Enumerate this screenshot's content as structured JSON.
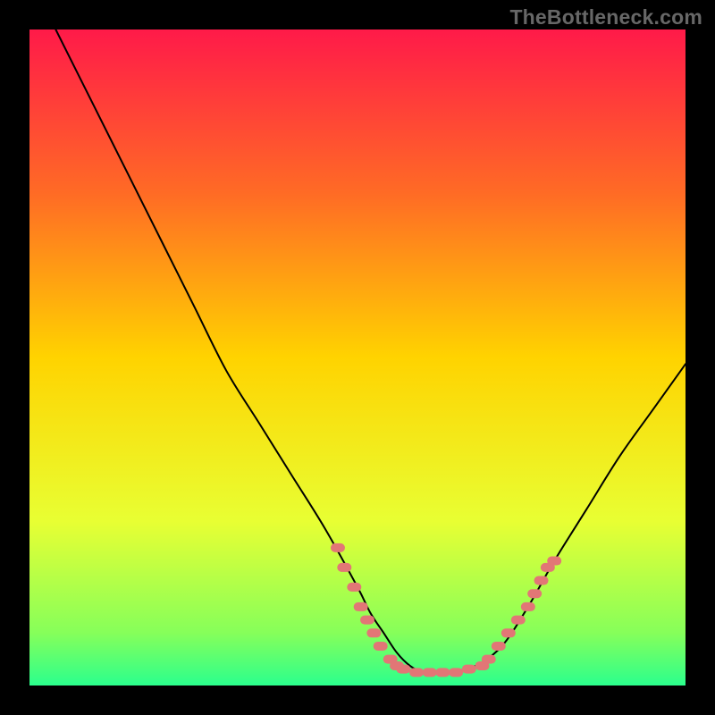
{
  "watermark": "TheBottleneck.com",
  "colors": {
    "frame": "#000000",
    "gradient_top": "#ff1a49",
    "gradient_25": "#ff6b25",
    "gradient_50": "#ffd300",
    "gradient_75": "#e8ff33",
    "gradient_92": "#86ff5a",
    "gradient_bottom": "#2bff8d",
    "curve": "#000000",
    "dots": "#e27676"
  },
  "chart_data": {
    "type": "line",
    "title": "",
    "xlabel": "",
    "ylabel": "",
    "xlim": [
      0,
      100
    ],
    "ylim": [
      0,
      100
    ],
    "grid": false,
    "legend": false,
    "series": [
      {
        "name": "bottleneck-curve",
        "x": [
          4,
          10,
          15,
          20,
          25,
          30,
          35,
          40,
          45,
          50,
          52,
          54,
          56,
          58,
          60,
          62,
          64,
          68,
          72,
          76,
          80,
          85,
          90,
          95,
          100
        ],
        "y": [
          100,
          88,
          78,
          68,
          58,
          48,
          40,
          32,
          24,
          15,
          11,
          8,
          5,
          3,
          2,
          2,
          2,
          3,
          6,
          12,
          19,
          27,
          35,
          42,
          49
        ]
      }
    ],
    "dot_clusters": {
      "left": {
        "x_range": [
          47,
          56
        ],
        "y_range": [
          3,
          21
        ],
        "points": [
          [
            47,
            21
          ],
          [
            48,
            18
          ],
          [
            49.5,
            15
          ],
          [
            50.5,
            12
          ],
          [
            51.5,
            10
          ],
          [
            52.5,
            8
          ],
          [
            53.5,
            6
          ],
          [
            55,
            4
          ],
          [
            56,
            3
          ]
        ]
      },
      "right": {
        "x_range": [
          70,
          80
        ],
        "y_range": [
          4,
          19
        ],
        "points": [
          [
            70,
            4
          ],
          [
            71.5,
            6
          ],
          [
            73,
            8
          ],
          [
            74.5,
            10
          ],
          [
            76,
            12
          ],
          [
            77,
            14
          ],
          [
            78,
            16
          ],
          [
            79,
            18
          ],
          [
            80,
            19
          ]
        ]
      },
      "bottom": {
        "x_range": [
          56,
          70
        ],
        "y_range": [
          2,
          3
        ],
        "points": [
          [
            57,
            2.5
          ],
          [
            59,
            2
          ],
          [
            61,
            2
          ],
          [
            63,
            2
          ],
          [
            65,
            2
          ],
          [
            67,
            2.5
          ],
          [
            69,
            3
          ]
        ]
      }
    }
  }
}
